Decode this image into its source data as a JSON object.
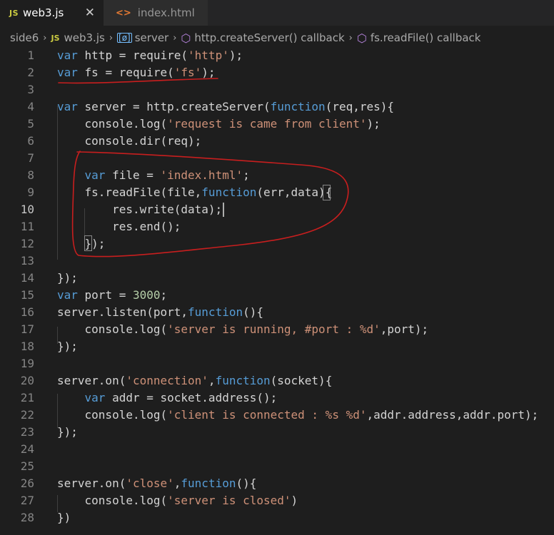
{
  "tabs": [
    {
      "icon": "JS",
      "label": "web3.js",
      "active": true,
      "close": "✕"
    },
    {
      "icon": "<>",
      "label": "index.html",
      "active": false
    }
  ],
  "breadcrumb": {
    "folder": "side6",
    "file_icon": "JS",
    "file": "web3.js",
    "var_icon": "[ø]",
    "symbol1": "server",
    "symbol2": "http.createServer() callback",
    "symbol3": "fs.readFile() callback"
  },
  "editor": {
    "current_line": 10,
    "lines": [
      {
        "n": "1"
      },
      {
        "n": "2"
      },
      {
        "n": "3"
      },
      {
        "n": "4"
      },
      {
        "n": "5"
      },
      {
        "n": "6"
      },
      {
        "n": "7"
      },
      {
        "n": "8"
      },
      {
        "n": "9"
      },
      {
        "n": "10"
      },
      {
        "n": "11"
      },
      {
        "n": "12"
      },
      {
        "n": "13"
      },
      {
        "n": "14"
      },
      {
        "n": "15"
      },
      {
        "n": "16"
      },
      {
        "n": "17"
      },
      {
        "n": "18"
      },
      {
        "n": "19"
      },
      {
        "n": "20"
      },
      {
        "n": "21"
      },
      {
        "n": "22"
      },
      {
        "n": "23"
      },
      {
        "n": "24"
      },
      {
        "n": "25"
      },
      {
        "n": "26"
      },
      {
        "n": "27"
      },
      {
        "n": "28"
      }
    ],
    "t": {
      "l1_kw": "var",
      "l1_a": " http = require(",
      "l1_s": "'http'",
      "l1_b": ");",
      "l2_kw": "var",
      "l2_a": " fs = require(",
      "l2_s": "'fs'",
      "l2_b": ");",
      "l4_kw": "var",
      "l4_a": " server = http.createServer(",
      "l4_kw2": "function",
      "l4_b": "(req,res){",
      "l5_a": "    console.log(",
      "l5_s": "'request is came from client'",
      "l5_b": ");",
      "l6_a": "    console.dir(req);",
      "l8_i": "    ",
      "l8_kw": "var",
      "l8_a": " file = ",
      "l8_s": "'index.html'",
      "l8_b": ";",
      "l9_a": "    fs.readFile(file,",
      "l9_kw": "function",
      "l9_b": "(err,data){",
      "l10_a": "        res.write(data);",
      "l11_a": "        res.end();",
      "l12_a": "    });",
      "l14_a": "});",
      "l15_kw": "var",
      "l15_a": " port = ",
      "l15_n": "3000",
      "l15_b": ";",
      "l16_a": "server.listen(port,",
      "l16_kw": "function",
      "l16_b": "(){",
      "l17_a": "    console.log(",
      "l17_s": "'server is running, #port : %d'",
      "l17_b": ",port);",
      "l18_a": "});",
      "l20_a": "server.on(",
      "l20_s": "'connection'",
      "l20_c": ",",
      "l20_kw": "function",
      "l20_b": "(socket){",
      "l21_i": "    ",
      "l21_kw": "var",
      "l21_a": " addr = socket.address();",
      "l22_a": "    console.log(",
      "l22_s": "'client is connected : %s %d'",
      "l22_b": ",addr.address,addr.port);",
      "l23_a": "});",
      "l26_a": "server.on(",
      "l26_s": "'close'",
      "l26_c": ",",
      "l26_kw": "function",
      "l26_b": "(){",
      "l27_a": "    console.log(",
      "l27_s": "'server is closed'",
      "l27_b": ")",
      "l28_a": "})"
    }
  },
  "annotations": {
    "color": "#c81e1e"
  },
  "colors": {
    "keyword": "#569cd6",
    "string": "#ce9178",
    "number": "#b5cea8",
    "text": "#d4d4d4"
  }
}
